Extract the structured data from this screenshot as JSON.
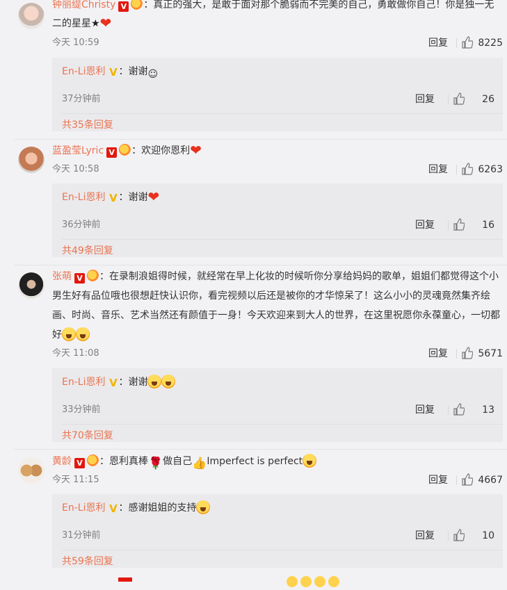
{
  "comments": [
    {
      "user": "钟丽缇Christy",
      "text": "：真正的强大，是敢于面对那个脆弱而不完美的自己，勇敢做你自己！你是独一无二的星星",
      "time": "今天 10:59",
      "reply_label": "回复",
      "likes": "8225",
      "reply": {
        "user": "En-Li恩利",
        "text": "：谢谢",
        "time": "37分钟前",
        "reply_label": "回复",
        "likes": "26",
        "more": "共35条回复"
      }
    },
    {
      "user": "蓝盈莹Lyric",
      "text": "：欢迎你恩利",
      "time": "今天 10:58",
      "reply_label": "回复",
      "likes": "6263",
      "reply": {
        "user": "En-Li恩利",
        "text": "：谢谢",
        "time": "36分钟前",
        "reply_label": "回复",
        "likes": "16",
        "more": "共49条回复"
      }
    },
    {
      "user": "张萌",
      "text": "：在录制浪姐得时候，就经常在早上化妆的时候听你分享给妈妈的歌单，姐姐们都觉得这个小男生好有品位哦也很想赶快认识你，看完视频以后还是被你的才华惊呆了！这么小小的灵魂竟然集齐绘画、时尚、音乐、艺术当然还有颜值于一身！今天欢迎来到大人的世界，在这里祝愿你永葆童心，一切都好",
      "time": "今天 11:08",
      "reply_label": "回复",
      "likes": "5671",
      "reply": {
        "user": "En-Li恩利",
        "text": "：谢谢",
        "time": "33分钟前",
        "reply_label": "回复",
        "likes": "13",
        "more": "共70条回复"
      }
    },
    {
      "user": "黄龄",
      "text_a": "：恩利真棒",
      "text_b": "做自己",
      "text_c": "Imperfect is perfect",
      "time": "今天 11:15",
      "reply_label": "回复",
      "likes": "4667",
      "reply": {
        "user": "En-Li恩利",
        "text": "：感谢姐姐的支持",
        "time": "31分钟前",
        "reply_label": "回复",
        "likes": "10",
        "more": "共59条回复"
      }
    }
  ],
  "icons": {
    "verified_red": "V",
    "verified_gold": "V",
    "like": "thumbs-up-icon",
    "heart": "heart-icon"
  },
  "colors": {
    "username": "#eb7350",
    "background": "#f2f2f5",
    "reply_box": "#eaeaec",
    "verified_red": "#e2180f",
    "verified_gold": "#f2b300",
    "heart": "#e8311e"
  }
}
